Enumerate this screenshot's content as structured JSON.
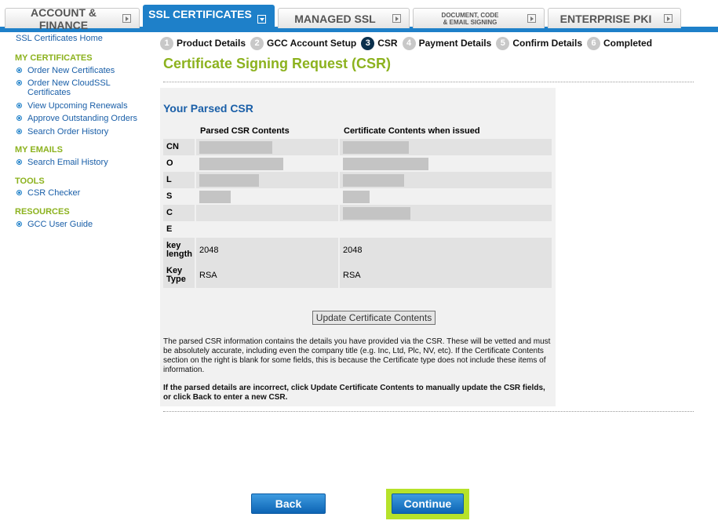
{
  "tabs": [
    {
      "label": "ACCOUNT & FINANCE",
      "active": false
    },
    {
      "label": "SSL CERTIFICATES",
      "active": true
    },
    {
      "label": "MANAGED SSL",
      "active": false
    },
    {
      "label_line1": "DOCUMENT, CODE",
      "label_line2": "& EMAIL SIGNING",
      "active": false
    },
    {
      "label": "ENTERPRISE PKI",
      "active": false
    }
  ],
  "sidebar": {
    "home": "SSL Certificates Home",
    "sections": [
      {
        "heading": "MY CERTIFICATES",
        "items": [
          "Order New Certificates",
          "Order New CloudSSL Certificates",
          "View Upcoming Renewals",
          "Approve Outstanding Orders",
          "Search Order History"
        ]
      },
      {
        "heading": "MY EMAILS",
        "items": [
          "Search Email History"
        ]
      },
      {
        "heading": "TOOLS",
        "items": [
          "CSR Checker"
        ]
      },
      {
        "heading": "RESOURCES",
        "items": [
          "GCC User Guide"
        ]
      }
    ]
  },
  "steps": [
    {
      "num": "1",
      "label": "Product Details",
      "current": false
    },
    {
      "num": "2",
      "label": "GCC Account Setup",
      "current": false
    },
    {
      "num": "3",
      "label": "CSR",
      "current": true
    },
    {
      "num": "4",
      "label": "Payment Details",
      "current": false
    },
    {
      "num": "5",
      "label": "Confirm Details",
      "current": false
    },
    {
      "num": "6",
      "label": "Completed",
      "current": false
    }
  ],
  "page_title": "Certificate Signing Request (CSR)",
  "panel": {
    "title": "Your Parsed CSR",
    "col_parsed": "Parsed CSR Contents",
    "col_issued": "Certificate Contents when issued",
    "rows": [
      {
        "key": "CN",
        "parsed": "",
        "issued": "",
        "parsed_redacted": true,
        "issued_redacted": true
      },
      {
        "key": "O",
        "parsed": "",
        "issued": "",
        "parsed_redacted": true,
        "issued_redacted": true
      },
      {
        "key": "L",
        "parsed": "",
        "issued": "",
        "parsed_redacted": true,
        "issued_redacted": true
      },
      {
        "key": "S",
        "parsed": "",
        "issued": "",
        "parsed_redacted": true,
        "issued_redacted": true
      },
      {
        "key": "C",
        "parsed": "",
        "issued": "",
        "parsed_redacted": false,
        "issued_redacted": true
      },
      {
        "key": "E",
        "parsed": "",
        "issued": "",
        "parsed_redacted": false,
        "issued_redacted": false
      },
      {
        "key_line1": "key",
        "key_line2": "length",
        "parsed": "2048",
        "issued": "2048"
      },
      {
        "key_line1": "Key",
        "key_line2": "Type",
        "parsed": "RSA",
        "issued": "RSA"
      }
    ],
    "update_button": "Update Certificate Contents",
    "note": "The parsed CSR information contains the details you have provided via the CSR. These will be vetted and must be absolutely accurate, including even the company title (e.g. Inc, Ltd, Plc, NV, etc). If the Certificate Contents section on the right is blank for some fields, this is because the Certificate type does not include these items of information.",
    "note_bold": "If the parsed details are incorrect, click Update Certificate Contents to manually update the CSR fields, or click Back to enter a new CSR."
  },
  "buttons": {
    "back": "Back",
    "continue": "Continue"
  }
}
